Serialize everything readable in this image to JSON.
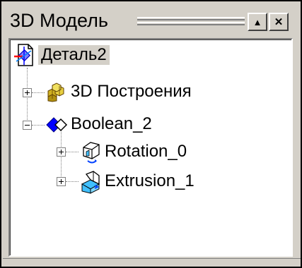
{
  "panel": {
    "title": "3D Модель",
    "buttons": {
      "up": "▲",
      "close": "✕"
    }
  },
  "tree": {
    "root": {
      "label": "Деталь2",
      "icon": "part-document-icon"
    },
    "items": [
      {
        "label": "3D Построения",
        "icon": "construction-cubes-icon",
        "expander": "plus"
      },
      {
        "label": "Boolean_2",
        "icon": "boolean-diamond-icon",
        "expander": "minus"
      },
      {
        "label": "Rotation_0",
        "icon": "rotation-feature-icon",
        "expander": "plus"
      },
      {
        "label": "Extrusion_1",
        "icon": "extrusion-feature-icon",
        "expander": "plus"
      }
    ]
  },
  "colors": {
    "window": "#d4d0c8",
    "tree_bg": "#ffffff",
    "accent_blue": "#0000ff"
  }
}
